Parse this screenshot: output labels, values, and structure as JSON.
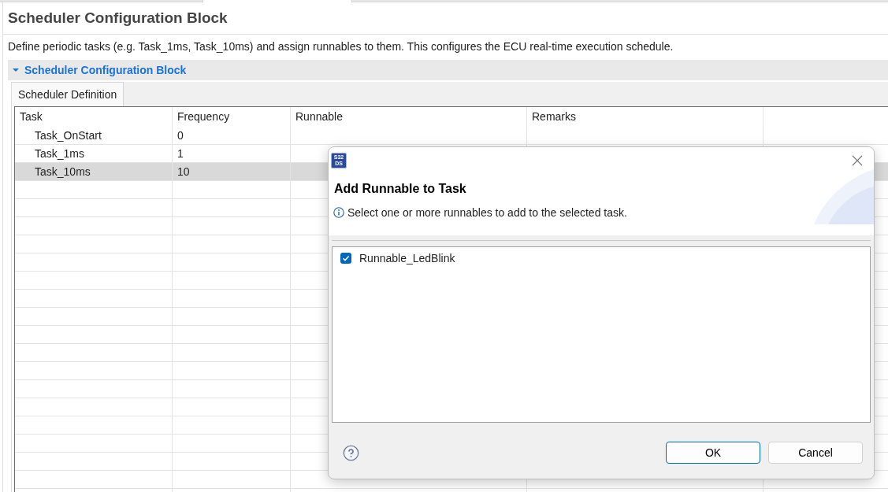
{
  "editor": {
    "title": "Scheduler Configuration Block",
    "description": "Define periodic tasks (e.g. Task_1ms, Task_10ms) and assign runnables to them. This configures the ECU real-time execution schedule."
  },
  "section": {
    "title": "Scheduler Configuration Block",
    "expanded": true
  },
  "tabs": [
    {
      "label": "Scheduler Definition",
      "selected": true
    }
  ],
  "table": {
    "columns": [
      "Task",
      "Frequency",
      "Runnable",
      "Remarks"
    ],
    "rows": [
      {
        "cells": [
          "Task_OnStart",
          "0"
        ],
        "selected": false
      },
      {
        "cells": [
          "Task_1ms",
          "1"
        ],
        "selected": false
      },
      {
        "cells": [
          "Task_10ms",
          "10"
        ],
        "selected": true
      }
    ]
  },
  "dialog": {
    "app_icon": [
      "S32",
      "DS"
    ],
    "title": "Add Runnable to Task",
    "message": "Select one or more runnables to add to the selected task.",
    "items": [
      {
        "label": "Runnable_LedBlink",
        "checked": true
      }
    ],
    "buttons": [
      {
        "label": "OK",
        "default": true
      },
      {
        "label": "Cancel",
        "default": false
      }
    ]
  }
}
